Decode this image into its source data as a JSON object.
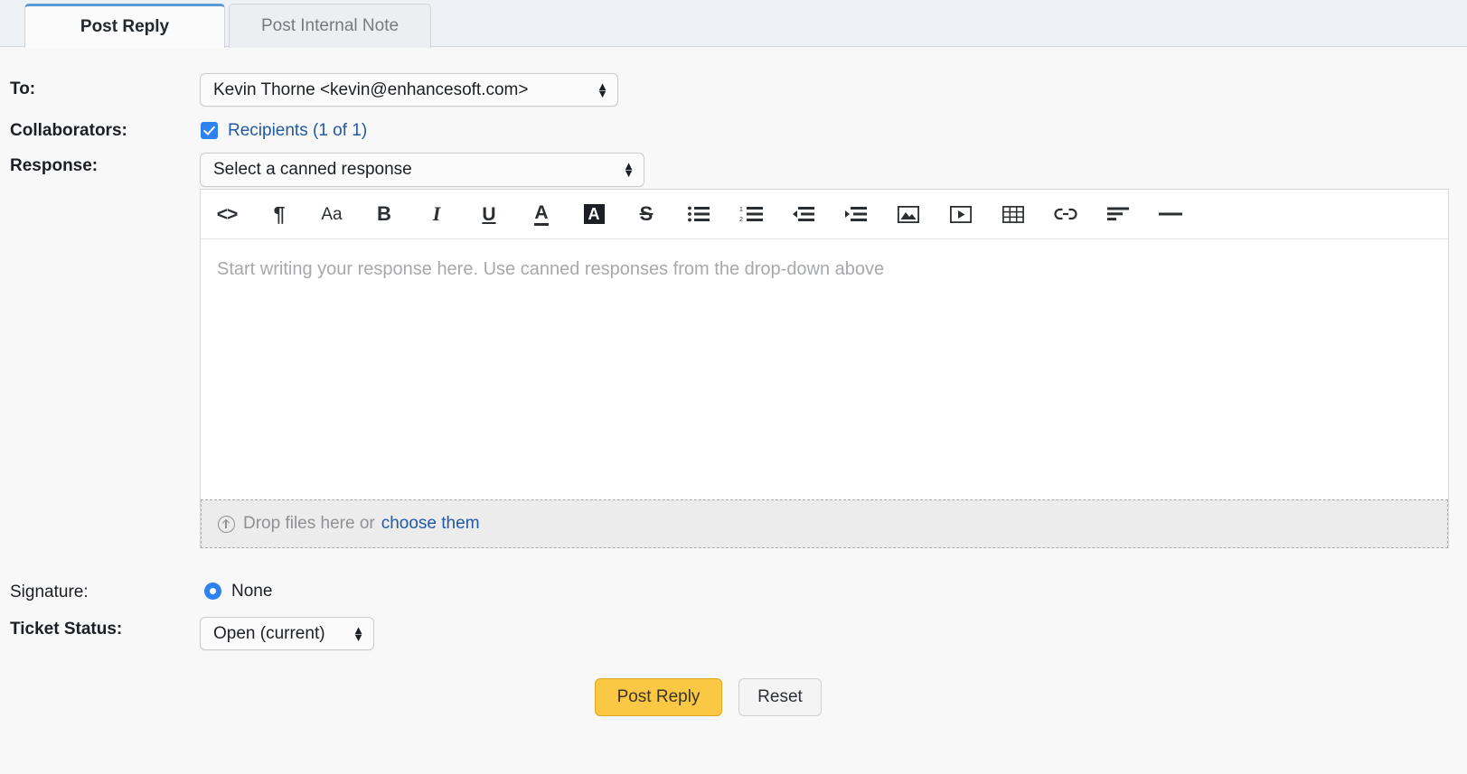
{
  "tabs": [
    {
      "label": "Post Reply",
      "active": true
    },
    {
      "label": "Post Internal Note",
      "active": false
    }
  ],
  "fields": {
    "to_label": "To:",
    "to_value": "Kevin Thorne <kevin@enhancesoft.com>",
    "collaborators_label": "Collaborators:",
    "collaborators_link": "Recipients (1 of 1)",
    "response_label": "Response:",
    "response_value": "Select a canned response",
    "signature_label": "Signature:",
    "signature_value": "None",
    "ticket_status_label": "Ticket Status:",
    "ticket_status_value": "Open (current)"
  },
  "editor": {
    "placeholder": "Start writing your response here. Use canned responses from the drop-down above",
    "dropzone_text": "Drop files here or",
    "dropzone_link": "choose them",
    "toolbar": [
      {
        "name": "source-code-icon",
        "glyph": "<>"
      },
      {
        "name": "paragraph-icon",
        "glyph": "¶"
      },
      {
        "name": "font-size-icon",
        "glyph": "Aa"
      },
      {
        "name": "bold-icon",
        "glyph": "B"
      },
      {
        "name": "italic-icon",
        "glyph": "I"
      },
      {
        "name": "underline-icon",
        "glyph": "U"
      },
      {
        "name": "text-color-icon",
        "glyph": "A"
      },
      {
        "name": "highlight-color-icon",
        "glyph": "A"
      },
      {
        "name": "strikethrough-icon",
        "glyph": "S"
      },
      {
        "name": "bulleted-list-icon",
        "glyph": ""
      },
      {
        "name": "numbered-list-icon",
        "glyph": ""
      },
      {
        "name": "outdent-icon",
        "glyph": ""
      },
      {
        "name": "indent-icon",
        "glyph": ""
      },
      {
        "name": "insert-image-icon",
        "glyph": ""
      },
      {
        "name": "insert-video-icon",
        "glyph": ""
      },
      {
        "name": "insert-table-icon",
        "glyph": ""
      },
      {
        "name": "insert-link-icon",
        "glyph": ""
      },
      {
        "name": "align-text-icon",
        "glyph": ""
      },
      {
        "name": "horizontal-rule-icon",
        "glyph": ""
      }
    ]
  },
  "buttons": {
    "post_reply": "Post Reply",
    "reset": "Reset"
  },
  "colors": {
    "accent_blue": "#2d82f0",
    "link_blue": "#2159a4",
    "primary_button": "#fbc846",
    "tab_active_border": "#5b9bd5"
  }
}
